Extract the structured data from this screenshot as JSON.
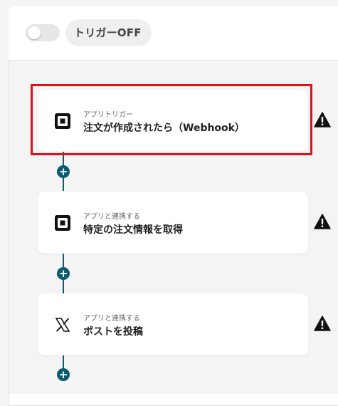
{
  "header": {
    "trigger_label": "トリガーOFF",
    "toggle_state": "off"
  },
  "steps": [
    {
      "subtitle": "アプリトリガー",
      "title": "注文が作成されたら（Webhook）",
      "app_icon": "square-icon",
      "warning": "warning-icon",
      "highlighted": true
    },
    {
      "subtitle": "アプリと連携する",
      "title": "特定の注文情報を取得",
      "app_icon": "square-icon",
      "warning": "warning-icon"
    },
    {
      "subtitle": "アプリと連携する",
      "title": "ポストを投稿",
      "app_icon": "x-logo-icon",
      "warning": "warning-icon"
    }
  ],
  "add_step_symbol": "+",
  "colors": {
    "connector": "#0d5b73",
    "highlight_border": "#e0101e"
  }
}
